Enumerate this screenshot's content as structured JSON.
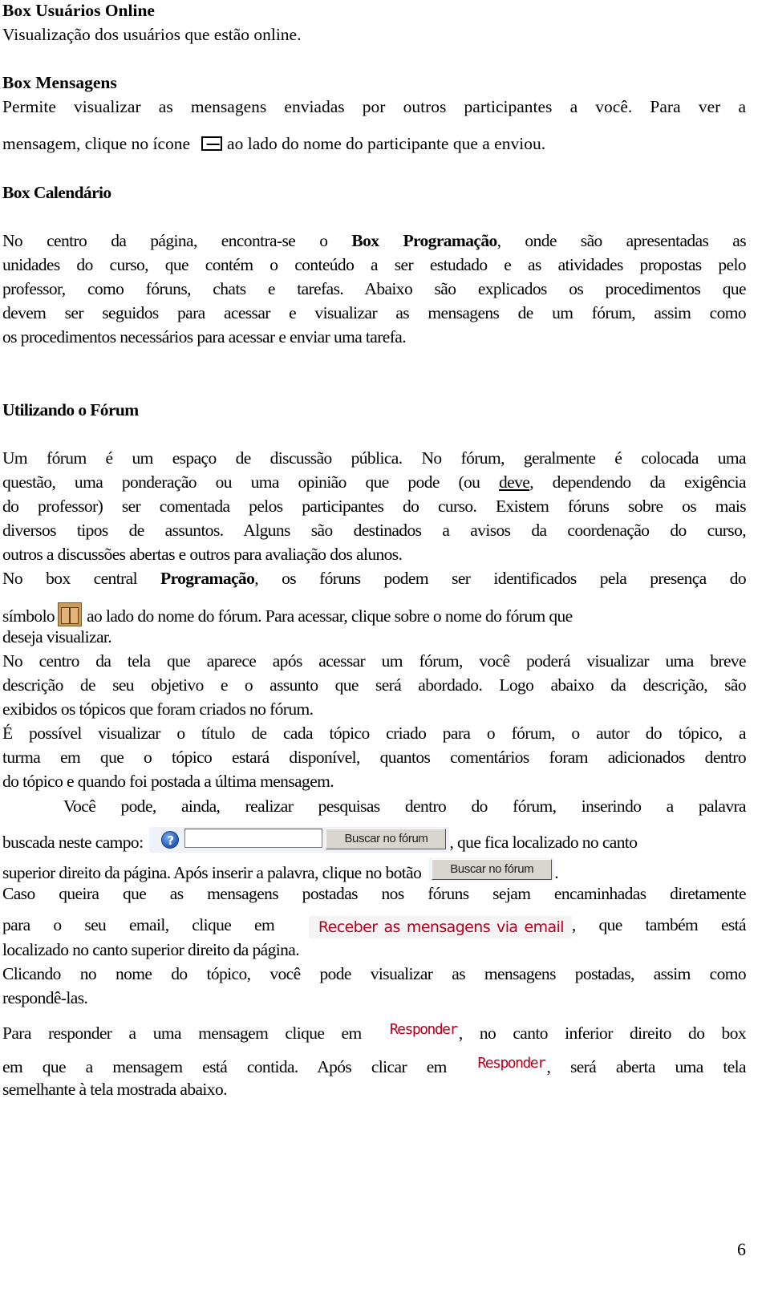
{
  "sections": {
    "online": {
      "title": "Box Usuários Online",
      "text": "Visualização dos usuários que estão online."
    },
    "messages": {
      "title": "Box Mensagens",
      "line1": "Permite visualizar as mensagens enviadas por outros participantes a você.  Para ver a",
      "line2_before": "mensagem, clique no ícone",
      "line2_after": "ao lado do nome do participante que a enviou.",
      "icon": "envelope-icon"
    },
    "calendar": {
      "title": "Box Calendário",
      "p1_l1_before": "No centro da página, encontra-se o",
      "p1_l1_bold": "Box Programação",
      "p1_l1_after": ", onde são apresentadas as",
      "p1_l2": "unidades do curso, que contém o conteúdo a ser estudado e as atividades propostas pelo",
      "p1_l3": "professor, como fóruns, chats e tarefas. Abaixo são explicados os procedimentos que",
      "p1_l4": "devem ser seguidos para acessar e visualizar as mensagens de um fórum, assim como",
      "p1_l5": "os procedimentos  necessários para acessar e enviar uma tarefa."
    },
    "forum": {
      "title": "Utilizando o Fórum",
      "l1": "Um fórum é um espaço de discussão pública. No fórum, geralmente é colocada uma",
      "l2_before": "questão, uma ponderação ou uma opinião que pode (ou",
      "l2_underline": "deve",
      "l2_after": ", dependendo da exigência",
      "l3": "do professor) ser comentada pelos participantes do curso. Existem fóruns sobre os mais",
      "l4": "diversos tipos de assuntos. Alguns são destinados a avisos da coordenação do curso,",
      "l5": "outros a discussões abertas e outros para avaliação dos alunos.",
      "l6_before": "No box central",
      "l6_bold": "Programação",
      "l6_after": ",  os fóruns podem ser identificados pela presença do",
      "l7_before": "símbolo",
      "l7_after": "ao lado do nome do fórum. Para acessar, clique sobre o nome do fórum que",
      "l7_icon": "forum-icon",
      "l8": "deseja visualizar.",
      "l9": "No centro da tela que aparece após acessar um fórum, você poderá visualizar uma breve",
      "l10": "descrição de seu objetivo e o assunto que será abordado. Logo abaixo da descrição, são",
      "l11": "exibidos os tópicos que foram criados no fórum.",
      "l12": "É possível visualizar o título de cada tópico criado para o fórum, o autor do tópico, a",
      "l13": "turma em que o tópico estará disponível, quantos comentários foram adicionados dentro",
      "l14": "do tópico e quando foi postada a última mensagem.",
      "l15": "Você pode, ainda, realizar pesquisas dentro do fórum, inserindo a palavra",
      "l16_before": "buscada neste campo:",
      "l16_after": ", que fica localizado no canto",
      "l17_before": "superior direito da página. Após inserir a palavra, clique no botão",
      "l17_after": ".",
      "l18": "Caso queira que as mensagens postadas nos fóruns sejam encaminhadas diretamente",
      "l19_before": "para o seu email, clique em",
      "l19_after": ", que também está",
      "l20": "localizado no canto superior direito da página.",
      "l21": "Clicando no nome do tópico, você pode visualizar as mensagens postadas, assim como",
      "l22": "respondê-las.",
      "l23_before": "Para responder a uma mensagem clique em",
      "l23_after": ", no canto inferior direito do box",
      "l24_before": "em que a mensagem está contida. Após clicar em",
      "l24_after": ", será aberta uma tela",
      "l25": "semelhante à tela mostrada abaixo."
    }
  },
  "widgets": {
    "search_help_icon": "?",
    "search_input_value": "",
    "search_button_label": "Buscar no fórum",
    "email_link_label": "Receber as mensagens via email",
    "reply_link_label": "Responder"
  },
  "colors": {
    "link_red": "#b3001e",
    "widget_bg": "#eef2f8",
    "button_gray": "#d8d5cf"
  },
  "page_number": "6"
}
